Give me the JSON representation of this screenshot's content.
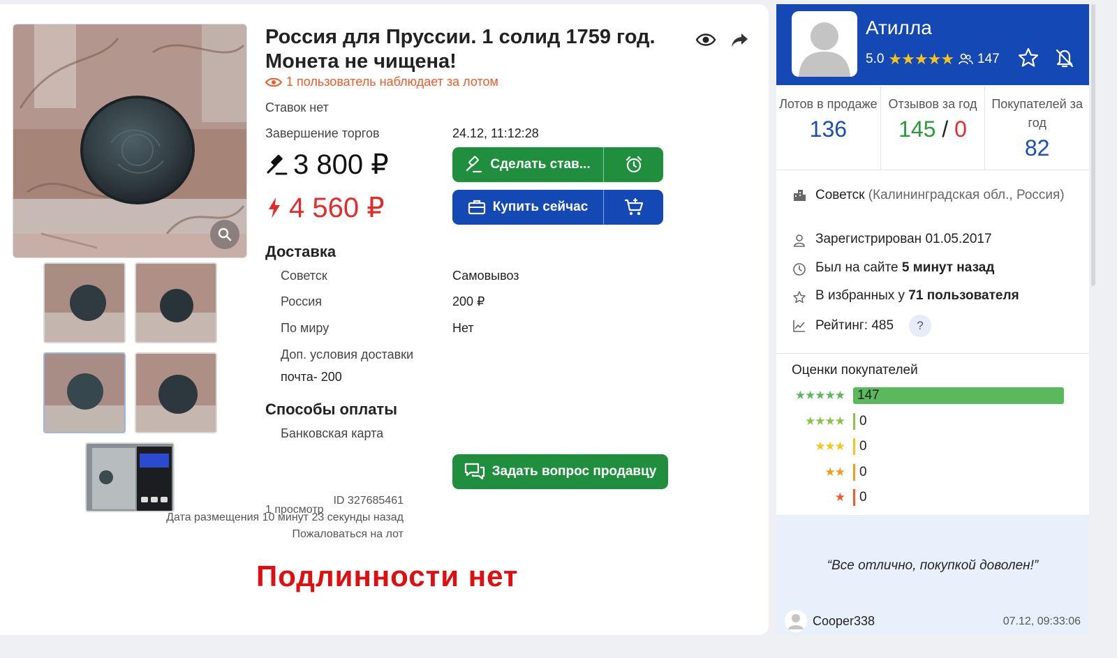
{
  "lot": {
    "title": "Россия для Пруссии. 1 солид 1759 год. Монета не чищена!",
    "watchers": "1 пользователь наблюдает за лотом",
    "bids_label": "Ставок нет",
    "end_label": "Завершение торгов",
    "end_value": "24.12, 11:12:28",
    "bid_price": "3 800 ₽",
    "buy_price": "4 560 ₽",
    "bid_button": "Сделать став...",
    "buy_button": "Купить сейчас",
    "delivery_title": "Доставка",
    "delivery": [
      {
        "place": "Советск",
        "value": "Самовывоз"
      },
      {
        "place": "Россия",
        "value": "200 ₽"
      },
      {
        "place": "По миру",
        "value": "Нет"
      }
    ],
    "delivery_extra_label": "Доп. условия доставки",
    "delivery_extra_value": "почта- 200",
    "payment_title": "Способы оплаты",
    "payment_method": "Банковская карта",
    "ask_button": "Задать вопрос продавцу",
    "views": "1 просмотр",
    "id_text": "ID 327685461",
    "posted_text": "Дата размещения 10 минут 23 секунды назад",
    "report_link": "Пожаловаться на лот",
    "notice": "Подлинности нет"
  },
  "seller": {
    "name": "Атилла",
    "rating": "5.0",
    "stars": "★★★★★",
    "reviews_count": "147",
    "stats": [
      {
        "label": "Лотов в продаже",
        "value": "136"
      },
      {
        "label": "Отзывов за год",
        "value_pos": "145",
        "sep": "/",
        "value_neg": "0"
      },
      {
        "label": "Покупателей за год",
        "value": "82"
      }
    ],
    "city": "Советск",
    "region": "(Калининградская обл., Россия)",
    "registered": "Зарегистрирован 01.05.2017",
    "last_seen_prefix": "Был на сайте",
    "last_seen_value": "5 минут назад",
    "favorites_prefix": "В избранных у",
    "favorites_value": "71 пользователя",
    "rating_label": "Рейтинг: 485",
    "help": "?",
    "buyer_ratings_title": "Оценки покупателей",
    "buyer_ratings": [
      {
        "stars": "★★★★★",
        "count": "147",
        "color": "#5cb85c"
      },
      {
        "stars": "★★★★",
        "count": "0",
        "color": "#8bc24a"
      },
      {
        "stars": "★★★",
        "count": "0",
        "color": "#f5c518"
      },
      {
        "stars": "★★",
        "count": "0",
        "color": "#f59a18"
      },
      {
        "stars": "★",
        "count": "0",
        "color": "#f05a28"
      }
    ],
    "review": {
      "text": "“Все отлично, покупкой доволен!”",
      "user": "Cooper338",
      "date": "07.12, 09:33:06"
    }
  },
  "colors": {
    "primary_blue": "#1448b4",
    "green": "#1f8f3e",
    "red": "#e32b2b",
    "orange": "#f05a28"
  }
}
